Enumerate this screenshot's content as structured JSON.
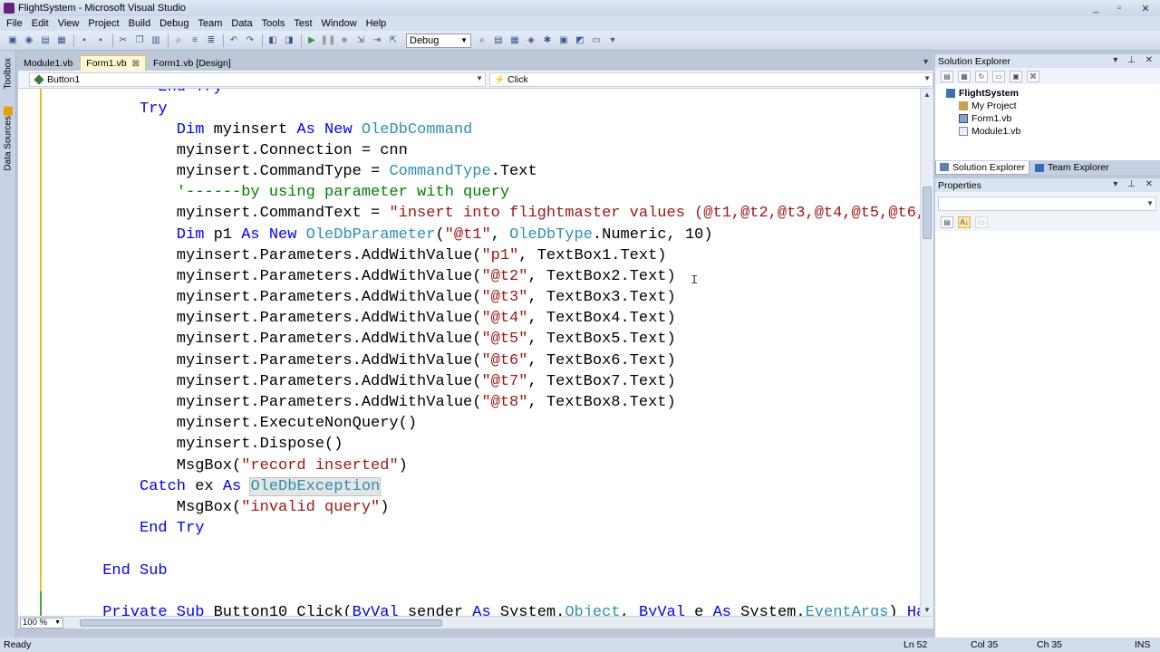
{
  "window": {
    "title": "FlightSystem - Microsoft Visual Studio",
    "controls": [
      "_",
      "▫",
      "✕"
    ]
  },
  "menu": [
    "File",
    "Edit",
    "View",
    "Project",
    "Build",
    "Debug",
    "Team",
    "Data",
    "Tools",
    "Test",
    "Window",
    "Help"
  ],
  "toolbar": {
    "configuration": "Debug"
  },
  "left_strip": {
    "toolbox": "Toolbox",
    "data_sources": "Data Sources"
  },
  "doc_tabs": [
    {
      "label": "Module1.vb",
      "active": false
    },
    {
      "label": "Form1.vb",
      "active": true
    },
    {
      "label": "Form1.vb [Design]",
      "active": false
    }
  ],
  "nav": {
    "object": "Button1",
    "member": "Click"
  },
  "editor": {
    "lines": [
      [
        [
          "kw",
          "End Try"
        ]
      ],
      [
        [
          "kw",
          "Try"
        ]
      ],
      [
        [
          "kw",
          "Dim"
        ],
        [
          "",
          " myinsert "
        ],
        [
          "kw",
          "As New"
        ],
        [
          "",
          " "
        ],
        [
          "ty",
          "OleDbCommand"
        ]
      ],
      [
        [
          "",
          "myinsert.Connection = cnn"
        ]
      ],
      [
        [
          "",
          "myinsert.CommandType = "
        ],
        [
          "ty",
          "CommandType"
        ],
        [
          "",
          ".Text"
        ]
      ],
      [
        [
          "cm",
          "'------by using parameter with query"
        ]
      ],
      [
        [
          "",
          "myinsert.CommandText = "
        ],
        [
          "st",
          "\"insert into flightmaster values (@t1,@t2,@t3,@t4,@t5,@t6,"
        ]
      ],
      [
        [
          "kw",
          "Dim"
        ],
        [
          "",
          " p1 "
        ],
        [
          "kw",
          "As New"
        ],
        [
          "",
          " "
        ],
        [
          "ty",
          "OleDbParameter"
        ],
        [
          "",
          "("
        ],
        [
          "st",
          "\"@t1\""
        ],
        [
          "",
          ", "
        ],
        [
          "ty",
          "OleDbType"
        ],
        [
          "",
          ".Numeric, 10)"
        ]
      ],
      [
        [
          "",
          "myinsert.Parameters.AddWithValue("
        ],
        [
          "st",
          "\"p1\""
        ],
        [
          "",
          ", TextBox1.Text)"
        ]
      ],
      [
        [
          "",
          "myinsert.Parameters.AddWithValue("
        ],
        [
          "st",
          "\"@t2\""
        ],
        [
          "",
          ", TextBox2.Text)"
        ]
      ],
      [
        [
          "",
          "myinsert.Parameters.AddWithValue("
        ],
        [
          "st",
          "\"@t3\""
        ],
        [
          "",
          ", TextBox3.Text)"
        ]
      ],
      [
        [
          "",
          "myinsert.Parameters.AddWithValue("
        ],
        [
          "st",
          "\"@t4\""
        ],
        [
          "",
          ", TextBox4.Text)"
        ]
      ],
      [
        [
          "",
          "myinsert.Parameters.AddWithValue("
        ],
        [
          "st",
          "\"@t5\""
        ],
        [
          "",
          ", TextBox5.Text)"
        ]
      ],
      [
        [
          "",
          "myinsert.Parameters.AddWithValue("
        ],
        [
          "st",
          "\"@t6\""
        ],
        [
          "",
          ", TextBox6.Text)"
        ]
      ],
      [
        [
          "",
          "myinsert.Parameters.AddWithValue("
        ],
        [
          "st",
          "\"@t7\""
        ],
        [
          "",
          ", TextBox7.Text)"
        ]
      ],
      [
        [
          "",
          "myinsert.Parameters.AddWithValue("
        ],
        [
          "st",
          "\"@t8\""
        ],
        [
          "",
          ", TextBox8.Text)"
        ]
      ],
      [
        [
          "",
          "myinsert.ExecuteNonQuery()"
        ]
      ],
      [
        [
          "",
          "myinsert.Dispose()"
        ]
      ],
      [
        [
          "",
          "MsgBox("
        ],
        [
          "st",
          "\"record inserted\""
        ],
        [
          "",
          ")"
        ]
      ],
      [
        [
          "kw",
          "Catch"
        ],
        [
          "",
          " ex "
        ],
        [
          "kw",
          "As"
        ],
        [
          "",
          " "
        ],
        [
          "hlty",
          "OleDbException"
        ]
      ],
      [
        [
          "",
          "MsgBox("
        ],
        [
          "st",
          "\"invalid query\""
        ],
        [
          "",
          ")"
        ]
      ],
      [
        [
          "kw",
          "End Try"
        ]
      ],
      [
        [
          "",
          ""
        ]
      ],
      [
        [
          "kw",
          "End Sub"
        ]
      ],
      [
        [
          "",
          ""
        ]
      ],
      [
        [
          "kw",
          "Private Sub"
        ],
        [
          "",
          " Button10_Click("
        ],
        [
          "kw",
          "ByVal"
        ],
        [
          "",
          " sender "
        ],
        [
          "kw",
          "As"
        ],
        [
          "",
          " System."
        ],
        [
          "ty",
          "Object"
        ],
        [
          "",
          ", "
        ],
        [
          "kw",
          "ByVal"
        ],
        [
          "",
          " e "
        ],
        [
          "kw",
          "As"
        ],
        [
          "",
          " System."
        ],
        [
          "ty",
          "EventArgs"
        ],
        [
          "",
          ") "
        ],
        [
          "kw",
          "Ha"
        ]
      ]
    ],
    "zoom": "100 %"
  },
  "solution_explorer": {
    "title": "Solution Explorer",
    "root": "FlightSystem",
    "items": [
      "My Project",
      "Form1.vb",
      "Module1.vb"
    ],
    "tabs": [
      "Solution Explorer",
      "Team Explorer"
    ]
  },
  "properties": {
    "title": "Properties"
  },
  "status": {
    "text": "Ready",
    "ln": "Ln 52",
    "col": "Col 35",
    "ch": "Ch 35",
    "mode": "INS"
  }
}
